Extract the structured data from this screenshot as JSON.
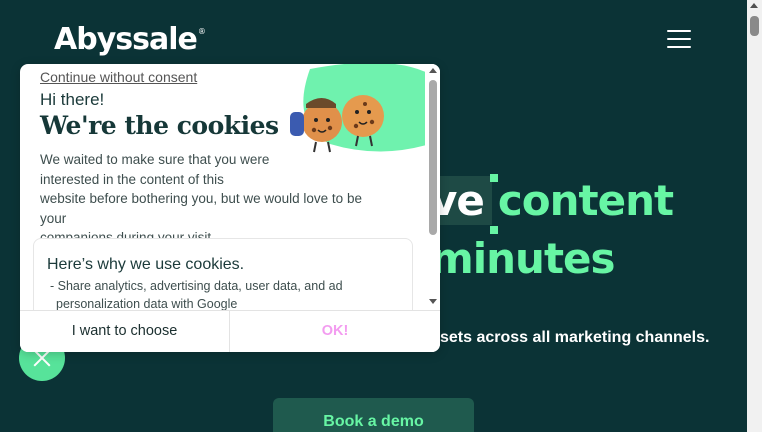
{
  "brand": {
    "logo_text": "Abyssale",
    "logo_mark": "®"
  },
  "header": {
    "menu_icon": "hamburger-menu-icon"
  },
  "hero": {
    "line1_highlight": "ve",
    "line1_green": "content",
    "line2": "minutes",
    "subtitle": "sets across all marketing channels.",
    "cta": "Book a demo",
    "accent_color": "#67f5a4"
  },
  "cookie_modal": {
    "continue_link": "Continue without consent",
    "greeting": "Hi there!",
    "title": "We're the cookies",
    "intro_lines": [
      "We waited to make sure that you were",
      "interested in the content of this",
      "website before bothering you, but we would love to be your",
      "companions during your visit..."
    ],
    "why_title": "Here’s why we use cookies.",
    "why_item_lines": [
      "- Share analytics, advertising data, user data, and ad",
      "personalization data with Google"
    ],
    "choose_button": "I want to choose",
    "ok_button": "OK!",
    "ok_color": "#f39cf0"
  },
  "floating_button": {
    "icon": "close-icon"
  }
}
